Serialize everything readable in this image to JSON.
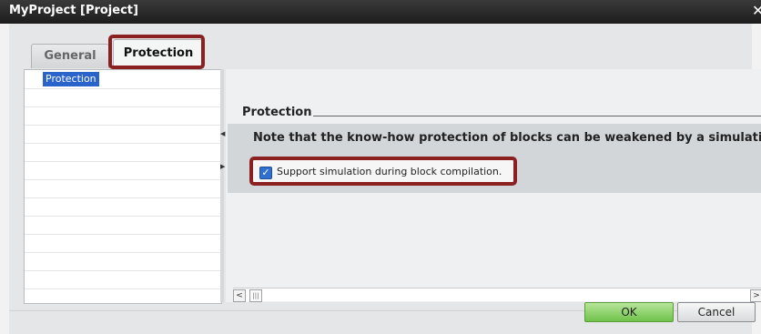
{
  "window": {
    "title": "MyProject [Project]"
  },
  "tabs": [
    {
      "label": "General",
      "active": false
    },
    {
      "label": "Protection",
      "active": true
    }
  ],
  "nav": {
    "items": [
      {
        "label": "Protection",
        "selected": true
      }
    ]
  },
  "section": {
    "heading": "Protection",
    "note": "Note that the know-how protection of blocks can be weakened by a simulation.",
    "checkbox": {
      "label": "Support simulation during block compilation.",
      "checked": true
    }
  },
  "buttons": {
    "ok": "OK",
    "cancel": "Cancel"
  },
  "icons": {
    "close": "close-icon",
    "scroll_left": "chevron-left-icon",
    "scroll_right": "chevron-right-icon",
    "scroll_thumb": "scroll-thumb-icon",
    "split_left": "chevron-left-icon",
    "split_right": "chevron-right-icon"
  },
  "colors": {
    "title_bar": "#1c1c1c",
    "highlight": "#8b2020",
    "selection": "#2a63c9",
    "ok_button": "#6fc24a"
  }
}
